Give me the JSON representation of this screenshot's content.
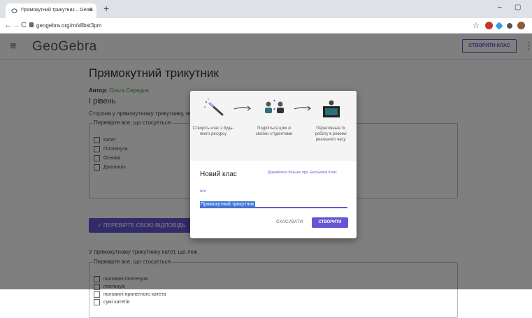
{
  "browser": {
    "tab_title": "Прямокутний трикутник – GeoG",
    "tab_close": "×",
    "new_tab": "+",
    "minimize": "–",
    "maximize": "▢",
    "back": "←",
    "forward": "→",
    "reload": "C",
    "url": "geogebra.org/m/x8bst3pm",
    "star": "☆"
  },
  "header": {
    "menu_glyph": "≡",
    "logo": "GeoGebra",
    "create_class_label": "СТВОРИТИ КЛАС",
    "more_glyph": "⋮"
  },
  "page": {
    "title": "Прямокутний трикутник",
    "author_label": "Автор:",
    "author_name": "Ольга Середня",
    "level": "І рівень",
    "question1": "Сторона у прямокутному трикутнику, яка",
    "legend1": "Перевірте все, що стосується",
    "options1": [
      "Катет",
      "Гіпотенуза",
      "Основа",
      "Діагональ"
    ],
    "check_button": "✓  ПЕРЕВІРТЕ СВОЮ ВІДПОВІДЬ",
    "question2": "У прямокутному трикутнику катет, що леж",
    "legend2": "Перевірте все, що стосується",
    "options2": [
      "половині гіпотенузи",
      "гіпотенузі",
      "половині прилеглого катета",
      "сумі катетів"
    ]
  },
  "dialog": {
    "steps": [
      {
        "icon": "magic-wand-icon",
        "text": "Створіть клас з будь-якого ресурсу"
      },
      {
        "icon": "students-icon",
        "text": "Поділіться цим зі своїми студентами"
      },
      {
        "icon": "monitor-icon",
        "text": "Перегляньте їх роботу в режимі реального часу"
      }
    ],
    "title": "Новий клас",
    "learn_more": "Дізнайтеся більше про GeoGebra Клас",
    "name_label": "Ім'я",
    "name_value": "Прямокутний трикутник",
    "cancel": "СКАСУВАТИ",
    "submit": "СТВОРИТИ"
  },
  "colors": {
    "accent": "#6557d2",
    "author_green": "#3c9b3c",
    "selection_blue": "#3d78d6"
  }
}
